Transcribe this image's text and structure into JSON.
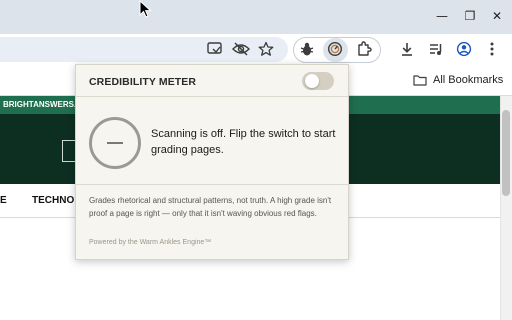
{
  "browser": {
    "window_controls": {
      "minimize_glyph": "—",
      "restore_glyph": "❐",
      "close_glyph": "✕"
    },
    "toolbar_icons": [
      "cast-icon",
      "eye-off-icon",
      "star-icon",
      "bug-icon",
      "gauge-icon",
      "puzzle-icon",
      "download-icon",
      "media-queue-icon",
      "profile-icon",
      "menu-icon"
    ],
    "bookmarks": {
      "all_label": "All Bookmarks"
    }
  },
  "page": {
    "site_strip_text": "BRIGHTANSWERS.A",
    "nav": {
      "partial_item": "E",
      "tech_item": "TECHNO"
    }
  },
  "popup": {
    "title": "CREDIBILITY METER",
    "toggle_on": false,
    "status": "Scanning is off. Flip the switch to start grading pages.",
    "disclaimer": "Grades rhetorical and structural patterns, not truth. A high grade isn't proof a page is right — only that it isn't waving obvious red flags.",
    "powered": "Powered by the Warm Ankles Engine™"
  },
  "colors": {
    "site_accent": "#1f6e4f",
    "site_header": "#0c2f22",
    "popup_bg": "#f7f5ef"
  }
}
